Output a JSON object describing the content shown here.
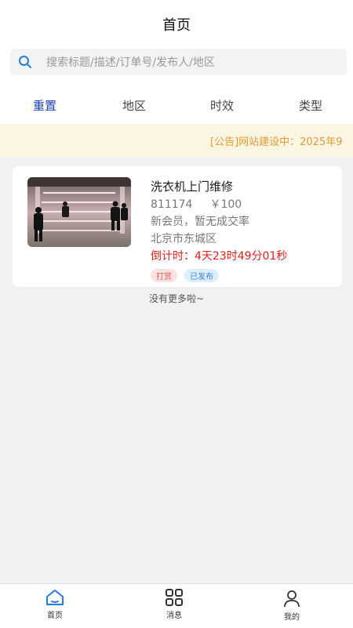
{
  "header": {
    "title": "首页"
  },
  "search": {
    "placeholder": "搜索标题/描述/订单号/发布人/地区"
  },
  "filters": [
    "重置",
    "地区",
    "时效",
    "类型"
  ],
  "notice": {
    "text": "[公告]网站建设中：2025年9"
  },
  "order": {
    "title": "洗衣机上门维修",
    "order_number": "811174",
    "price": "￥100",
    "member_status": "新会员，暂无成交率",
    "location": "北京市东城区",
    "countdown_label": "倒计时：",
    "countdown_value": "4天23时49分01秒",
    "tags": [
      "打赏",
      "已发布"
    ]
  },
  "no_more": "没有更多啦~",
  "tabbar": {
    "home": "首页",
    "messages": "消息",
    "mine": "我的"
  },
  "colors": {
    "accent": "#1f43b8",
    "notice_text": "#e19c2f",
    "notice_bg": "#fdf5e4",
    "countdown": "#e02020",
    "tag_tip": "#e05555",
    "tag_published": "#3a86d8"
  }
}
